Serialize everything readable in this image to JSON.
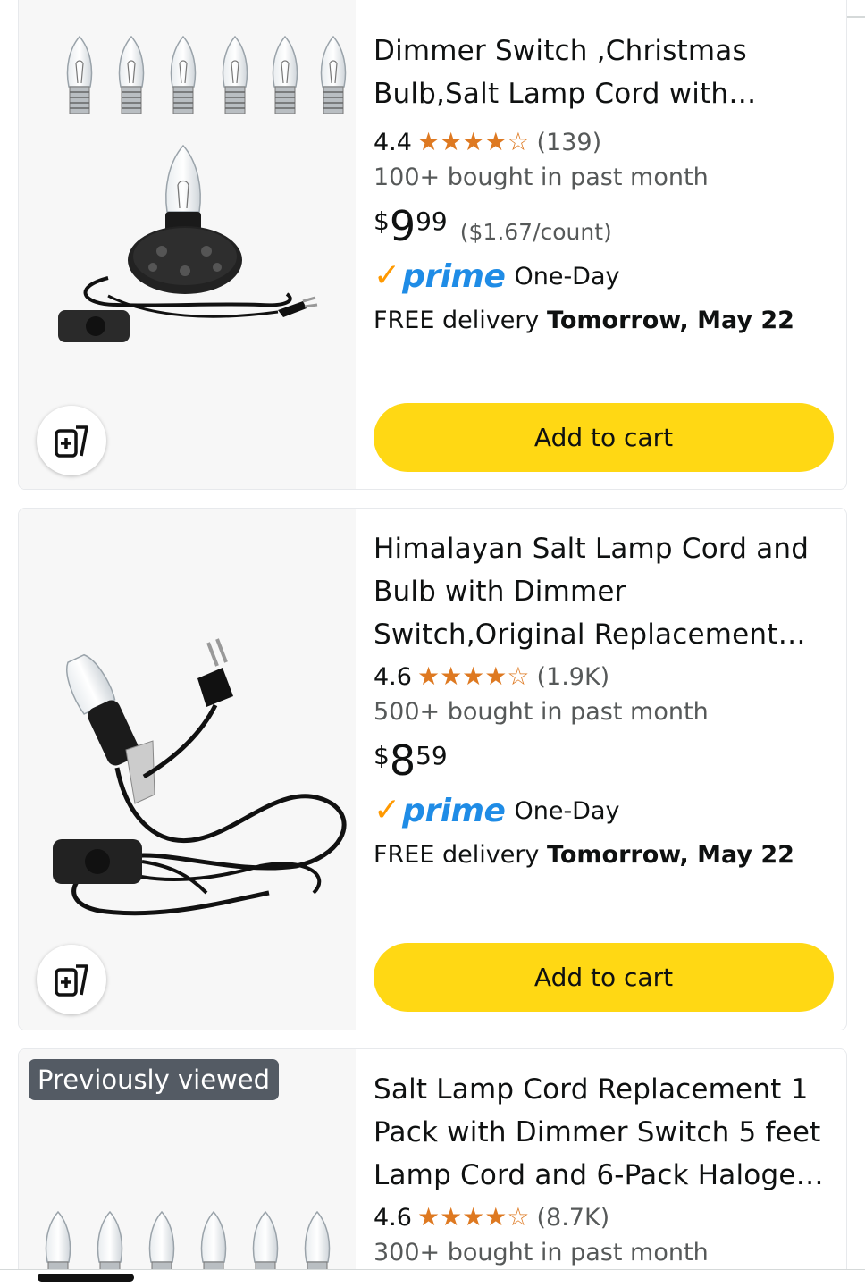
{
  "products": [
    {
      "title_visible": "Dimmer Switch ,Christmas Bulb,Salt Lamp Cord with…",
      "rating": "4.4",
      "stars_value": 4.4,
      "reviews": "(139)",
      "bought": "100+ bought in past month",
      "price_symbol": "$",
      "price_whole": "9",
      "price_fraction": "99",
      "unit_price": "($1.67/count)",
      "prime_label": "prime",
      "prime_speed": "One-Day",
      "delivery_prefix": "FREE delivery ",
      "delivery_date": "Tomorrow, May 22",
      "cart_label": "Add to cart"
    },
    {
      "title_visible": "Himalayan Salt Lamp Cord and Bulb with Dimmer Switch,Original Replacement…",
      "rating": "4.6",
      "stars_value": 4.6,
      "reviews": "(1.9K)",
      "bought": "500+ bought in past month",
      "price_symbol": "$",
      "price_whole": "8",
      "price_fraction": "59",
      "prime_label": "prime",
      "prime_speed": "One-Day",
      "delivery_prefix": "FREE delivery ",
      "delivery_date": "Tomorrow, May 22",
      "cart_label": "Add to cart"
    },
    {
      "badge": "Previously viewed",
      "title_visible": "Salt Lamp Cord Replacement 1 Pack with Dimmer Switch 5 feet Lamp Cord and 6-Pack Haloge…",
      "rating": "4.6",
      "stars_value": 4.6,
      "reviews": "(8.7K)",
      "bought": "300+ bought in past month"
    }
  ],
  "icons": {
    "compare": "add-to-compare-icon",
    "star": "star-icon",
    "prime_check": "prime-check-icon"
  },
  "colors": {
    "cart_button": "#ffd814",
    "star": "#de7921",
    "prime_blue": "#1f8ce6",
    "prime_check": "#ff9900",
    "secondary_text": "#565959",
    "badge_bg": "#545b64"
  }
}
